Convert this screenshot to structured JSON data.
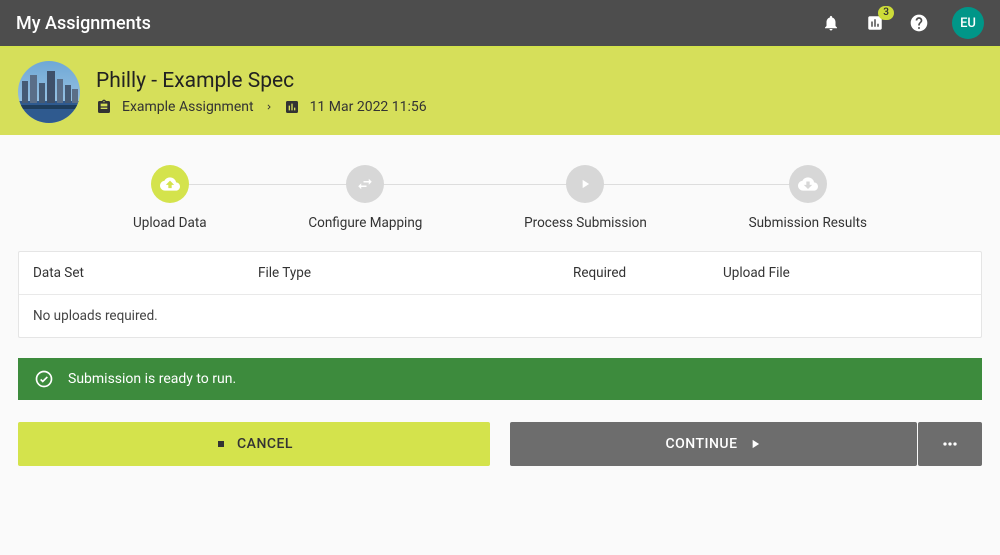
{
  "topbar": {
    "title": "My Assignments",
    "badge_count": "3",
    "avatar_initials": "EU"
  },
  "banner": {
    "title": "Philly - Example Spec",
    "assignment_label": "Example Assignment",
    "timestamp": "11 Mar 2022 11:56"
  },
  "stepper": {
    "step1": "Upload Data",
    "step2": "Configure Mapping",
    "step3": "Process Submission",
    "step4": "Submission Results"
  },
  "table": {
    "headers": {
      "dataset": "Data Set",
      "filetype": "File Type",
      "required": "Required",
      "upload": "Upload File"
    },
    "empty_message": "No uploads required."
  },
  "status": {
    "message": "Submission is ready to run."
  },
  "actions": {
    "cancel": "CANCEL",
    "continue": "CONTINUE"
  }
}
